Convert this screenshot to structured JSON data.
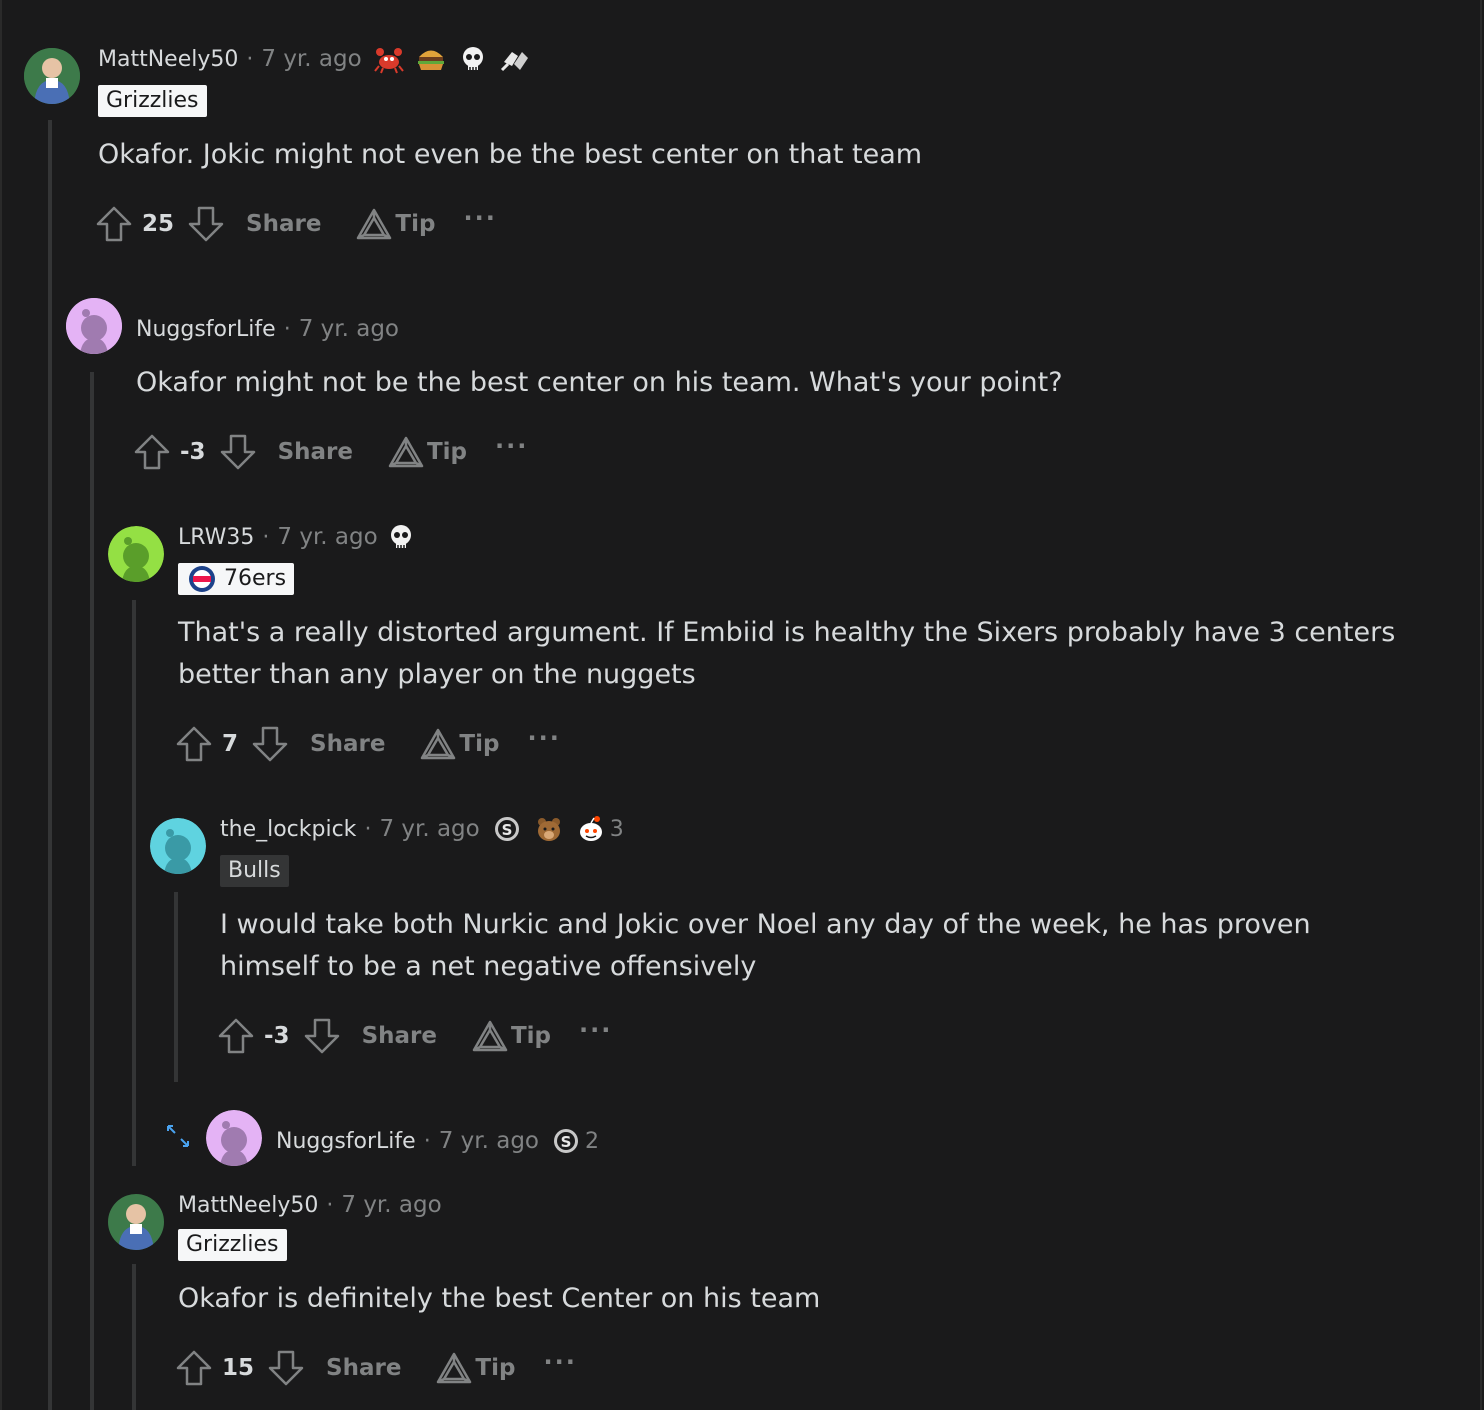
{
  "comments": [
    {
      "username": "MattNeely50",
      "time": "7 yr. ago",
      "flair": "Grizzlies",
      "text": "Okafor. Jokic might not even be the best center on that team",
      "score": "25",
      "share_label": "Share",
      "tip_label": "Tip",
      "awards": [
        "crab-award-icon",
        "burger-award-icon",
        "skull-award-icon",
        "fist-bump-award-icon"
      ]
    },
    {
      "username": "NuggsforLife",
      "time": "7 yr. ago",
      "text": "Okafor might not be the best center on his team. What's your point?",
      "score": "-3",
      "share_label": "Share",
      "tip_label": "Tip"
    },
    {
      "username": "LRW35",
      "time": "7 yr. ago",
      "flair": "76ers",
      "flair_icon": "76ers-logo-icon",
      "text_line1": "That's a really distorted argument. If Embiid is healthy the Sixers probably have 3 centers",
      "text_line2": "better than any player on the nuggets",
      "score": "7",
      "share_label": "Share",
      "tip_label": "Tip",
      "awards": [
        "skull-award-icon"
      ]
    },
    {
      "username": "the_lockpick",
      "time": "7 yr. ago",
      "flair": "Bulls",
      "text_line1": "I would take both Nurkic and Jokic over Noel any day of the week, he has proven",
      "text_line2": "himself to be a net negative offensively",
      "score": "-3",
      "share_label": "Share",
      "tip_label": "Tip",
      "awards": [
        "silver-award-icon",
        "bear-award-icon",
        "snoo-award-icon"
      ],
      "award_count": "3"
    },
    {
      "username": "NuggsforLife",
      "time": "7 yr. ago",
      "awards": [
        "silver-award-icon"
      ],
      "award_count": "2",
      "collapsed": true
    },
    {
      "username": "MattNeely50",
      "time": "7 yr. ago",
      "flair": "Grizzlies",
      "text": "Okafor is definitely the best Center on his team",
      "score": "15",
      "share_label": "Share",
      "tip_label": "Tip"
    }
  ],
  "separator": "·",
  "more_label": "···",
  "colors": {
    "background": "#1a1a1b",
    "text": "#d7dadc",
    "muted": "#818384",
    "thread_line": "#343536",
    "expand_accent": "#0079d3"
  }
}
